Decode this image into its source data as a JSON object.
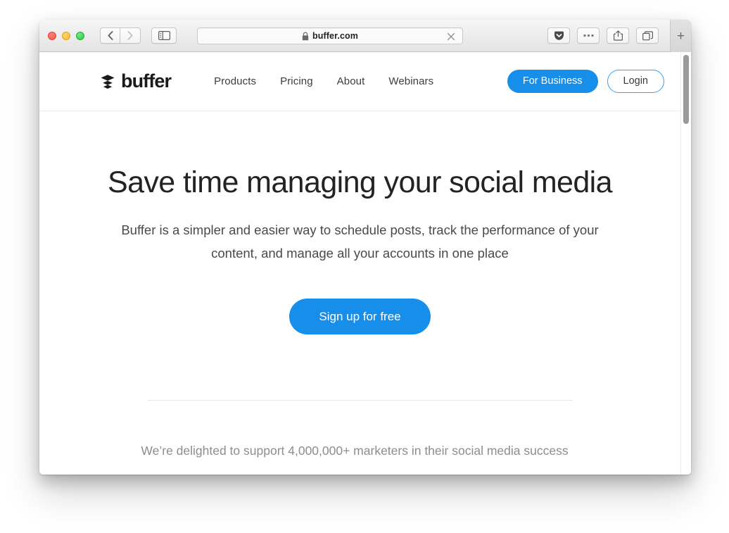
{
  "browser": {
    "traffic_lights": [
      "close",
      "minimize",
      "maximize"
    ],
    "back_icon": "chevron-left-icon",
    "forward_icon": "chevron-right-icon",
    "sidebar_icon": "sidebar-toggle-icon",
    "address": {
      "lock_icon": "lock-icon",
      "url": "buffer.com",
      "clear_icon": "close-icon"
    },
    "right_buttons": [
      {
        "name": "pocket-button",
        "icon": "pocket-icon"
      },
      {
        "name": "more-button",
        "icon": "ellipsis-icon"
      },
      {
        "name": "share-button",
        "icon": "share-icon"
      },
      {
        "name": "tabs-button",
        "icon": "tabs-overview-icon"
      }
    ],
    "new_tab_label": "+"
  },
  "site": {
    "brand": {
      "name": "buffer",
      "mark_icon": "buffer-layers-icon"
    },
    "nav_links": [
      {
        "label": "Products"
      },
      {
        "label": "Pricing"
      },
      {
        "label": "About"
      },
      {
        "label": "Webinars"
      }
    ],
    "actions": {
      "for_business": "For Business",
      "login": "Login"
    },
    "hero": {
      "headline": "Save time managing your social media",
      "subheadline": "Buffer is a simpler and easier way to schedule posts, track the performance of your content, and manage all your accounts in one place",
      "cta": "Sign up for free"
    },
    "social_proof": "We’re delighted to support 4,000,000+ marketers in their social media success"
  },
  "colors": {
    "brand_blue": "#168eea",
    "text_dark": "#232323",
    "text_muted": "#8d8d8d",
    "border_light": "#e9e9e9"
  }
}
